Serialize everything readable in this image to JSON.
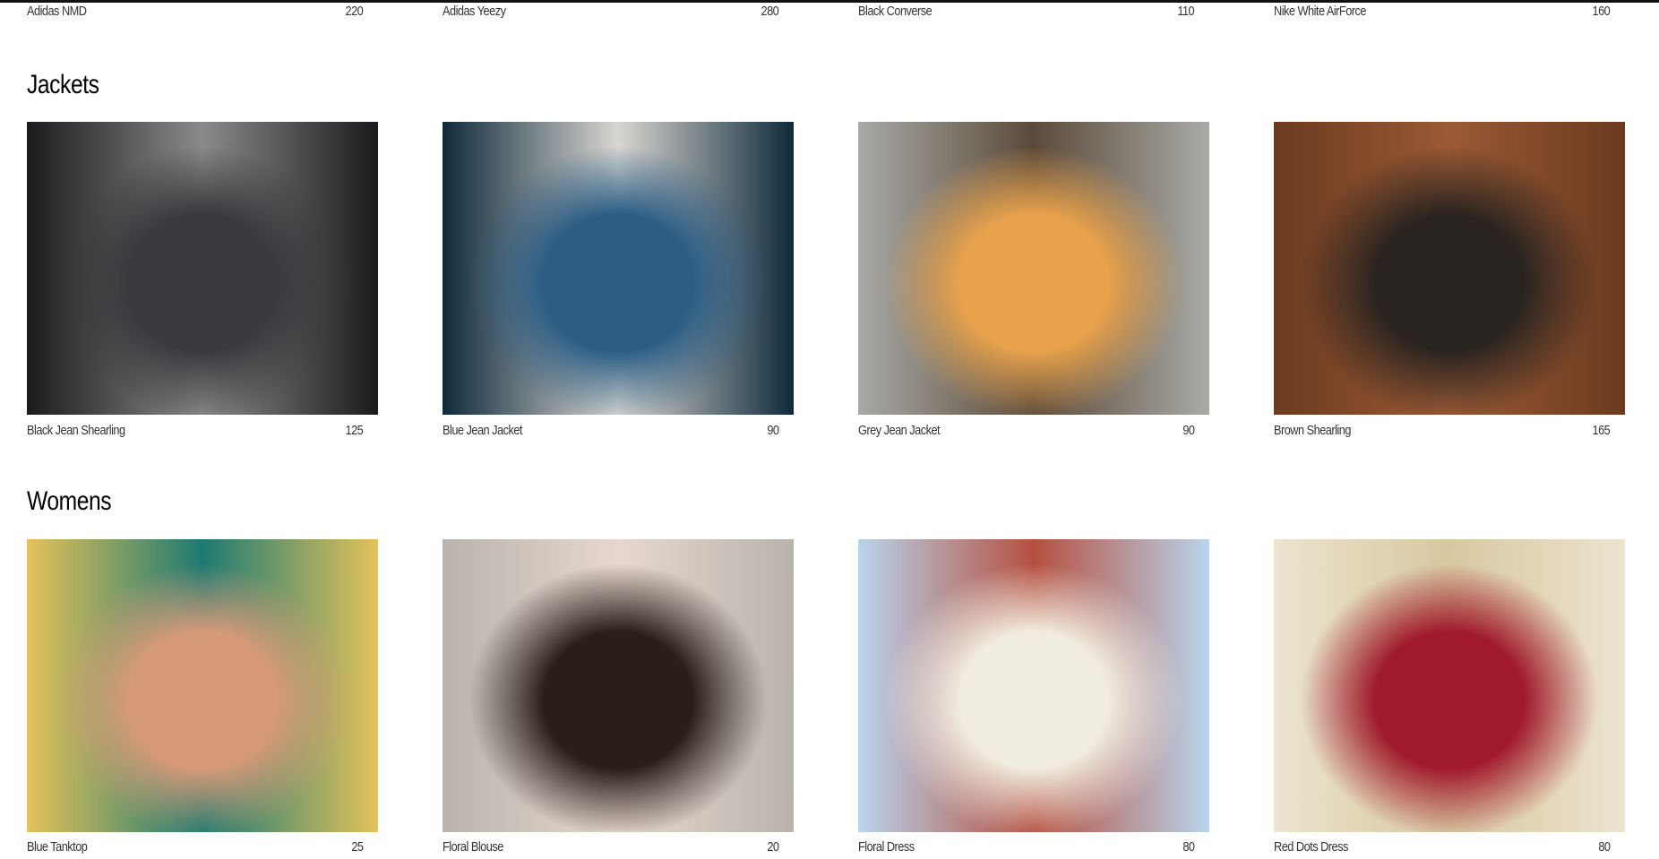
{
  "top_row": [
    {
      "name": "Adidas NMD",
      "price": "220"
    },
    {
      "name": "Adidas Yeezy",
      "price": "280"
    },
    {
      "name": "Black Converse",
      "price": "110"
    },
    {
      "name": "Nike White AirForce",
      "price": "160"
    }
  ],
  "sections": [
    {
      "title": "Jackets",
      "items": [
        {
          "name": "Black Jean Shearling",
          "price": "125",
          "colors": [
            "#1b1b1d",
            "#3a3a3e",
            "#8a8a8c"
          ]
        },
        {
          "name": "Blue Jean Jacket",
          "price": "90",
          "colors": [
            "#0f2a3c",
            "#2b5d85",
            "#d8d6d0"
          ]
        },
        {
          "name": "Grey Jean Jacket",
          "price": "90",
          "colors": [
            "#a9aaa6",
            "#e8a24c",
            "#5a4a3a"
          ]
        },
        {
          "name": "Brown Shearling",
          "price": "165",
          "colors": [
            "#6b3a20",
            "#2a2420",
            "#9a5a34"
          ]
        }
      ]
    },
    {
      "title": "Womens",
      "items": [
        {
          "name": "Blue Tanktop",
          "price": "25",
          "colors": [
            "#e5c25a",
            "#d69a78",
            "#1d7a72"
          ]
        },
        {
          "name": "Floral Blouse",
          "price": "20",
          "colors": [
            "#b8b3ac",
            "#2a1e1a",
            "#e7d8cf"
          ]
        },
        {
          "name": "Floral Dress",
          "price": "80",
          "colors": [
            "#b9d4ec",
            "#f1ece0",
            "#b5503f"
          ]
        },
        {
          "name": "Red Dots Dress",
          "price": "80",
          "colors": [
            "#ece4d0",
            "#a01a2c",
            "#d8c8a0"
          ]
        }
      ]
    }
  ]
}
